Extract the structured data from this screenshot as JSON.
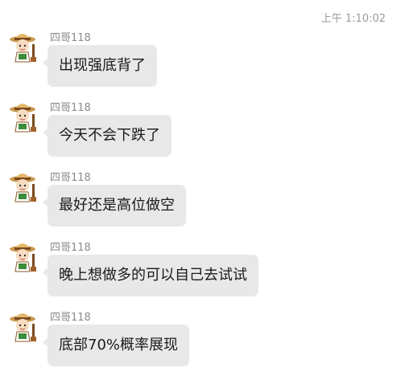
{
  "header": {
    "timestamp": "上午 1:10:02"
  },
  "sender_avatar_icon": "cartoon-avatar-icon",
  "messages": [
    {
      "sender": "四哥118",
      "text": "出现强底背了"
    },
    {
      "sender": "四哥118",
      "text": "今天不会下跌了"
    },
    {
      "sender": "四哥118",
      "text": "最好还是高位做空"
    },
    {
      "sender": "四哥118",
      "text": "晚上想做多的可以自己去试试"
    },
    {
      "sender": "四哥118",
      "text": "底部70%概率展现"
    }
  ]
}
